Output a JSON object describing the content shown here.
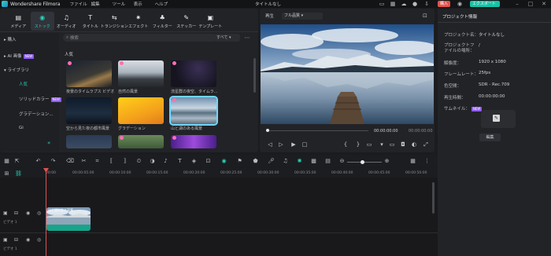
{
  "titlebar": {
    "app_name": "Wondershare Filmora",
    "menu": [
      "ファイル",
      "編集",
      "ツール",
      "表示",
      "ヘルプ"
    ],
    "project_name": "タイトルなし",
    "buy_label": "購入",
    "export_label": "エクスポート"
  },
  "toolbar": {
    "items": [
      {
        "label": "メディア",
        "icon": "media-icon"
      },
      {
        "label": "ストック",
        "icon": "stock-icon"
      },
      {
        "label": "オーディオ",
        "icon": "audio-icon"
      },
      {
        "label": "タイトル",
        "icon": "title-icon"
      },
      {
        "label": "トランジション",
        "icon": "transition-icon"
      },
      {
        "label": "エフェクト",
        "icon": "effect-icon"
      },
      {
        "label": "フィルター",
        "icon": "filter-icon"
      },
      {
        "label": "ステッカー",
        "icon": "sticker-icon"
      },
      {
        "label": "テンプレート",
        "icon": "template-icon"
      }
    ]
  },
  "sidebar": {
    "items": [
      {
        "label": "購入"
      },
      {
        "label": "AI 画像",
        "badge": "NEW"
      },
      {
        "label": "ライブラリ"
      },
      {
        "label": "人気"
      },
      {
        "label": "ソリッドカラー",
        "badge": "NEW"
      },
      {
        "label": "グラデーション..."
      },
      {
        "label": "Gi"
      }
    ]
  },
  "media": {
    "search_placeholder": "検索",
    "filter_label": "すべて",
    "category": "人気",
    "thumbs": [
      {
        "caption": "夜景のタイムラプス ビデオ..."
      },
      {
        "caption": "自然の風景"
      },
      {
        "caption": "流星群の夜空、タイムラ..."
      },
      {
        "caption": "空から見た夜の都市風景"
      },
      {
        "caption": "グラデーション"
      },
      {
        "caption": "山と湖のある風景"
      },
      {
        "caption": ""
      },
      {
        "caption": ""
      },
      {
        "caption": ""
      }
    ]
  },
  "preview": {
    "label": "再生",
    "quality": "フル品質",
    "current_time": "00:00:00:00",
    "total_time": "00:00:00:00"
  },
  "properties": {
    "tab": "プロジェクト情報",
    "rows": [
      {
        "label": "プロジェクト名：",
        "value": "タイトルなし"
      },
      {
        "label": "プロジェクトファイルの場所：",
        "value": "/"
      },
      {
        "label": "解像度：",
        "value": "1920 x 1080"
      },
      {
        "label": "フレームレート：",
        "value": "25fps"
      },
      {
        "label": "色空間：",
        "value": "SDR - Rec.709"
      },
      {
        "label": "再生時間：",
        "value": "00:00:00:00"
      },
      {
        "label": "サムネイル：",
        "value": "",
        "badge": "NEW"
      }
    ],
    "edit_label": "編集"
  },
  "timeline": {
    "ruler": [
      "00:00",
      "00:00:05:00",
      "00:00:10:00",
      "00:00:15:00",
      "00:00:20:00",
      "00:00:25:00",
      "00:00:30:00",
      "00:00:35:00",
      "00:00:40:00",
      "00:00:45:00",
      "00:00:50:00"
    ],
    "tracks": [
      {
        "name": "ビデオ 1"
      },
      {
        "name": "ビデオ 1"
      }
    ],
    "clip_label": "山と湖のある風景"
  },
  "colors": {
    "accent": "#27d3b8",
    "export": "#16c2a8",
    "buy": "#e0524a",
    "playhead": "#e05050",
    "clip": "#17a48a"
  }
}
